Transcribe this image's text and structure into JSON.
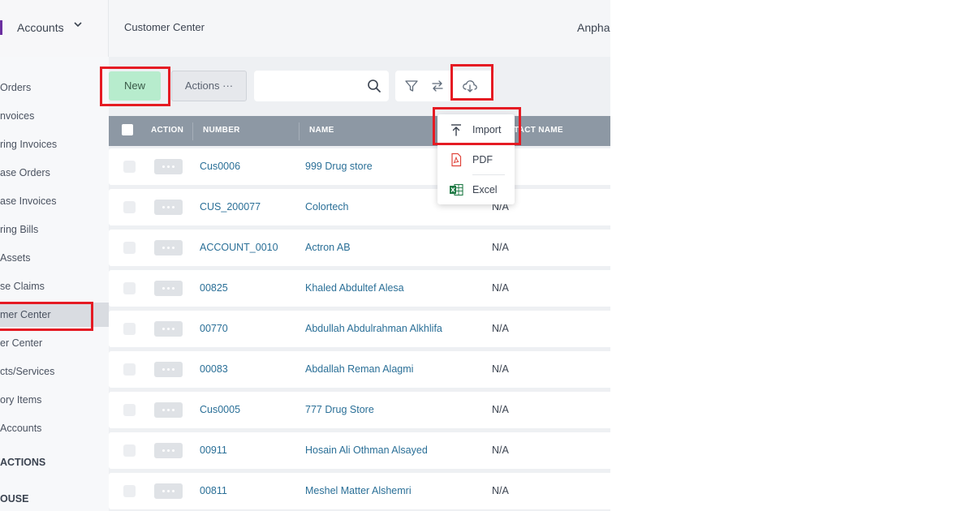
{
  "header": {
    "module_selector": "Accounts",
    "page_title": "Customer Center",
    "company_name": "Anpha"
  },
  "sidebar": {
    "items": [
      {
        "label": "Orders"
      },
      {
        "label": "nvoices"
      },
      {
        "label": "ring Invoices"
      },
      {
        "label": "ase Orders"
      },
      {
        "label": "ase Invoices"
      },
      {
        "label": "ring Bills"
      },
      {
        "label": "Assets"
      },
      {
        "label": "se Claims"
      },
      {
        "label": "mer Center"
      },
      {
        "label": "er Center"
      },
      {
        "label": "cts/Services"
      },
      {
        "label": "ory Items"
      },
      {
        "label": "Accounts"
      }
    ],
    "active_index": 8,
    "sections": [
      {
        "label": "ACTIONS"
      },
      {
        "label": "OUSE"
      }
    ]
  },
  "toolbar": {
    "new_label": "New",
    "actions_label": "Actions ···",
    "search_placeholder": ""
  },
  "export_menu": {
    "items": [
      {
        "label": "Import",
        "icon": "upload-icon"
      },
      {
        "label": "PDF",
        "icon": "pdf-file-icon"
      },
      {
        "label": "Excel",
        "icon": "excel-file-icon"
      }
    ]
  },
  "table": {
    "columns": [
      "ACTION",
      "NUMBER",
      "NAME",
      "CONTACT NAME"
    ],
    "column_visible_text": [
      "ACTION",
      "NUMBER",
      "NAME",
      "TACT NAME"
    ],
    "rows": [
      {
        "number": "Cus0006",
        "name": "999 Drug store",
        "contact": ""
      },
      {
        "number": "CUS_200077",
        "name": "Colortech",
        "contact": "N/A"
      },
      {
        "number": "ACCOUNT_0010",
        "name": "Actron AB",
        "contact": "N/A"
      },
      {
        "number": "00825",
        "name": "Khaled Abdultef Alesa",
        "contact": "N/A"
      },
      {
        "number": "00770",
        "name": "Abdullah Abdulrahman Alkhlifa",
        "contact": "N/A"
      },
      {
        "number": "00083",
        "name": "Abdallah Reman Alagmi",
        "contact": "N/A"
      },
      {
        "number": "Cus0005",
        "name": "777 Drug Store",
        "contact": "N/A"
      },
      {
        "number": "00911",
        "name": "Hosain Ali Othman Alsayed",
        "contact": "N/A"
      },
      {
        "number": "00811",
        "name": "Meshel Matter Alshemri",
        "contact": "N/A"
      }
    ]
  },
  "colors": {
    "accent": "#6b2fa0",
    "new_button": "#b7eccd",
    "table_header": "#8d98a4",
    "link": "#2a6f97",
    "highlight_box": "#e51b23"
  }
}
